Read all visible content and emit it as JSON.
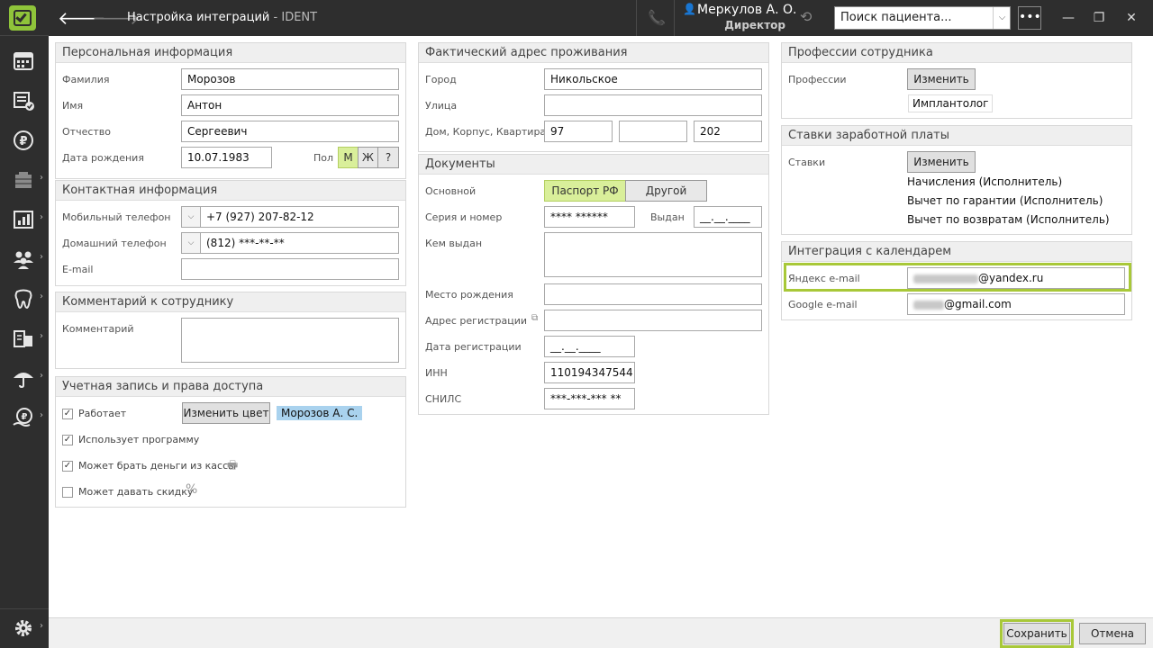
{
  "topbar": {
    "title": "Настройка интеграций",
    "title_sep": " - ",
    "app": "IDENT",
    "user_name": "Меркулов А. О.",
    "user_role": "Директор",
    "search_placeholder": "Поиск пациента..."
  },
  "personal": {
    "header": "Персональная информация",
    "lastname_label": "Фамилия",
    "lastname": "Морозов",
    "firstname_label": "Имя",
    "firstname": "Антон",
    "middlename_label": "Отчество",
    "middlename": "Сергеевич",
    "birth_label": "Дата рождения",
    "birth": "10.07.1983",
    "gender_label": "Пол",
    "gender_m": "М",
    "gender_f": "Ж",
    "gender_u": "?"
  },
  "contact": {
    "header": "Контактная информация",
    "mobile_label": "Мобильный телефон",
    "mobile": "+7 (927) 207-82-12",
    "home_label": "Домашний телефон",
    "home": "(812) ***-**-**",
    "email_label": "E-mail",
    "email": ""
  },
  "comment": {
    "header": "Комментарий к сотруднику",
    "label": "Комментарий",
    "value": ""
  },
  "account": {
    "header": "Учетная запись и права доступа",
    "works": "Работает",
    "change_color": "Изменить цвет",
    "color_name": "Морозов А. С.",
    "uses_program": "Использует программу",
    "cash": "Может брать деньги из кассы",
    "discount": "Может давать скидку"
  },
  "address": {
    "header": "Фактический адрес проживания",
    "city_label": "Город",
    "city": "Никольское",
    "street_label": "Улица",
    "street": "",
    "house_label": "Дом, Корпус, Квартира",
    "house": "97",
    "building": "",
    "flat": "202"
  },
  "documents": {
    "header": "Документы",
    "main_label": "Основной",
    "passport": "Паспорт РФ",
    "other": "Другой",
    "series_label": "Серия и номер",
    "series": "**** ******",
    "issued_label": "Выдан",
    "issued": "__.__.____",
    "issuer_label": "Кем выдан",
    "birthplace_label": "Место рождения",
    "reg_address_label": "Адрес регистрации",
    "reg_date_label": "Дата регистрации",
    "reg_date": "__.__.____",
    "inn_label": "ИНН",
    "inn": "110194347544",
    "snils_label": "СНИЛС",
    "snils": "***-***-*** **"
  },
  "professions": {
    "header": "Профессии сотрудника",
    "label": "Профессии",
    "change": "Изменить",
    "tag": "Имплантолог"
  },
  "salary": {
    "header": "Ставки заработной платы",
    "label": "Ставки",
    "change": "Изменить",
    "item1": "Начисления (Исполнитель)",
    "item2": "Вычет по гарантии (Исполнитель)",
    "item3": "Вычет по возвратам (Исполнитель)"
  },
  "calendar": {
    "header": "Интеграция с календарем",
    "yandex_label": "Яндекс e-mail",
    "yandex_domain": "@yandex.ru",
    "google_label": "Google e-mail",
    "google_domain": "@gmail.com"
  },
  "footer": {
    "save": "Сохранить",
    "cancel": "Отмена"
  },
  "colors": {
    "accent": "#a8c838",
    "sidebar": "#2e2e2e",
    "segment_on": "#d9ef9a",
    "user_icon": "#5aa9e6"
  },
  "icons": {
    "sidebar": [
      "calendar-icon",
      "tasks-icon",
      "ruble-icon",
      "warehouse-icon",
      "reports-icon",
      "patients-icon",
      "tooth-icon",
      "documents-icon",
      "insurance-icon",
      "finance-icon",
      "settings-icon"
    ]
  }
}
